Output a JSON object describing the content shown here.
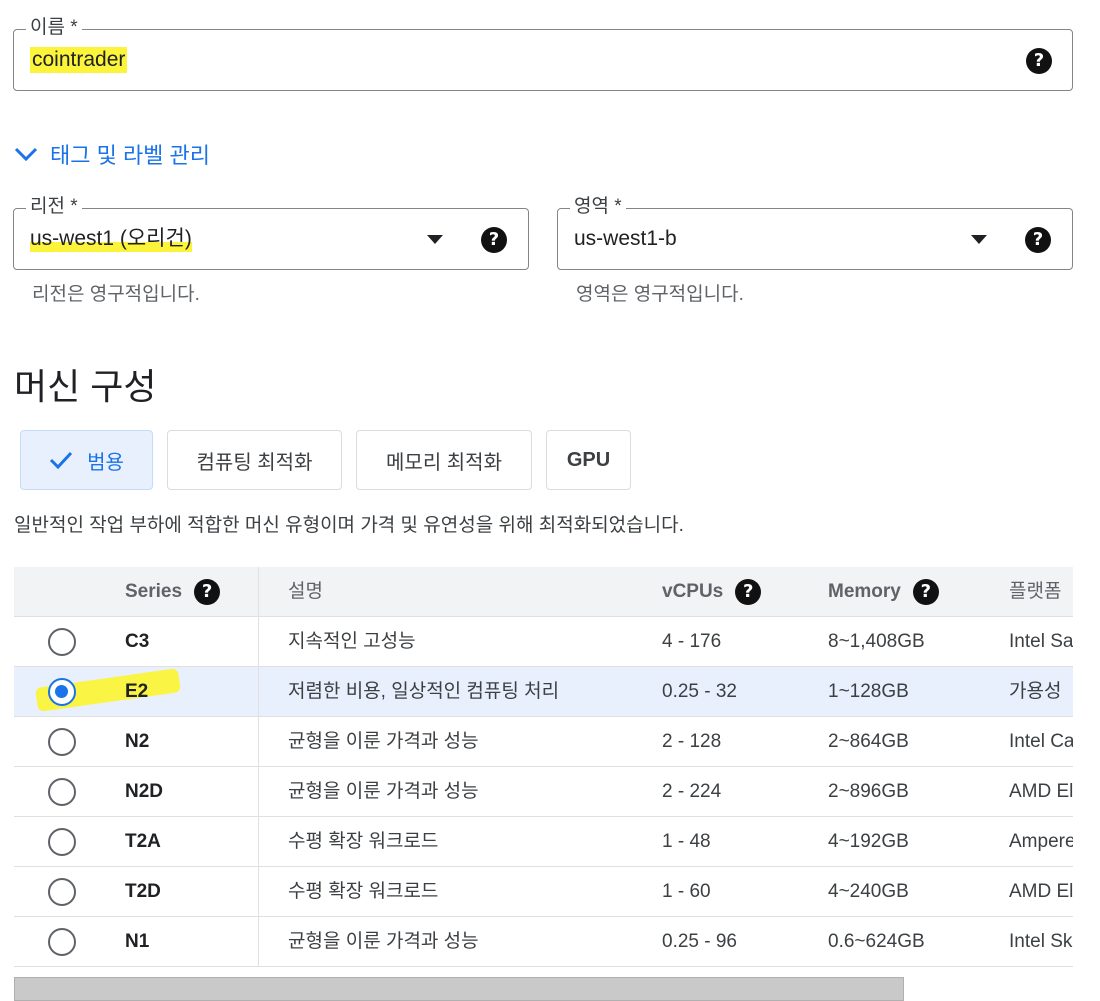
{
  "name_field": {
    "label": "이름 *",
    "value": "cointrader"
  },
  "tags_toggle": {
    "label": "태그 및 라벨 관리"
  },
  "region_field": {
    "label": "리전 *",
    "value": "us-west1 (오리건)",
    "hint": "리전은 영구적입니다."
  },
  "zone_field": {
    "label": "영역 *",
    "value": "us-west1-b",
    "hint": "영역은 영구적입니다."
  },
  "machine_config": {
    "title": "머신 구성",
    "tabs": [
      {
        "label": "범용",
        "selected": true
      },
      {
        "label": "컴퓨팅 최적화",
        "selected": false
      },
      {
        "label": "메모리 최적화",
        "selected": false
      },
      {
        "label": "GPU",
        "selected": false
      }
    ],
    "description": "일반적인 작업 부하에 적합한 머신 유형이며 가격 및 유연성을 위해 최적화되었습니다."
  },
  "table": {
    "headers": {
      "series": "Series",
      "desc": "설명",
      "vcpus": "vCPUs",
      "memory": "Memory",
      "platform": "플랫폼"
    },
    "rows": [
      {
        "series": "C3",
        "desc": "지속적인 고성능",
        "vcpus": "4 - 176",
        "memory": "8~1,408GB",
        "platform": "Intel Sa",
        "selected": false
      },
      {
        "series": "E2",
        "desc": "저렴한 비용, 일상적인 컴퓨팅 처리",
        "vcpus": "0.25 - 32",
        "memory": "1~128GB",
        "platform": "가용성",
        "selected": true
      },
      {
        "series": "N2",
        "desc": "균형을 이룬 가격과 성능",
        "vcpus": "2 - 128",
        "memory": "2~864GB",
        "platform": "Intel Ca",
        "selected": false
      },
      {
        "series": "N2D",
        "desc": "균형을 이룬 가격과 성능",
        "vcpus": "2 - 224",
        "memory": "2~896GB",
        "platform": "AMD El",
        "selected": false
      },
      {
        "series": "T2A",
        "desc": "수평 확장 워크로드",
        "vcpus": "1 - 48",
        "memory": "4~192GB",
        "platform": "Ampere",
        "selected": false
      },
      {
        "series": "T2D",
        "desc": "수평 확장 워크로드",
        "vcpus": "1 - 60",
        "memory": "4~240GB",
        "platform": "AMD El",
        "selected": false
      },
      {
        "series": "N1",
        "desc": "균형을 이룬 가격과 성능",
        "vcpus": "0.25 - 96",
        "memory": "0.6~624GB",
        "platform": "Intel Sk",
        "selected": false
      }
    ]
  },
  "colors": {
    "accent": "#1a73e8",
    "highlight": "#fbf43b",
    "selected_bg": "#e8f0fe"
  }
}
